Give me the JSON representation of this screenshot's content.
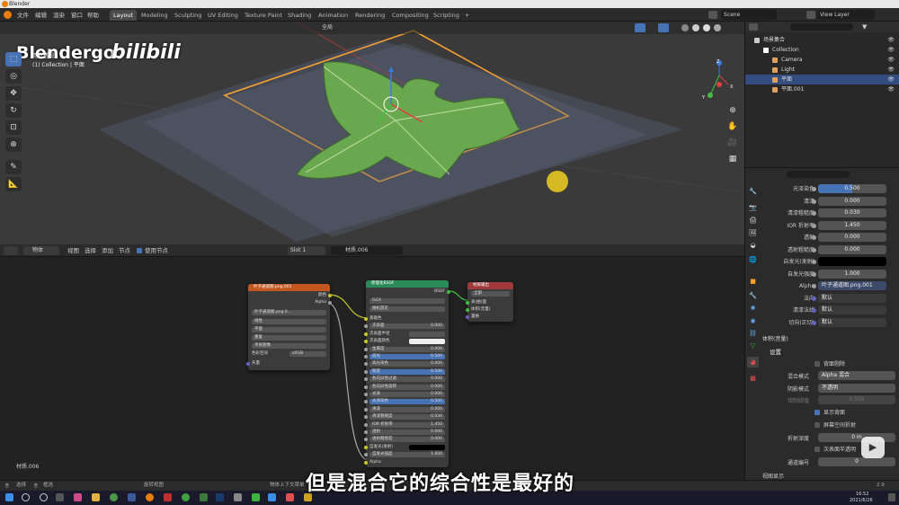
{
  "titlebar": {
    "app": "Blender"
  },
  "menu": {
    "items": [
      "文件",
      "编辑",
      "渲染",
      "窗口",
      "帮助"
    ]
  },
  "workspaces": [
    "Layout",
    "Modeling",
    "Sculpting",
    "UV Editing",
    "Texture Paint",
    "Shading",
    "Animation",
    "Rendering",
    "Compositing",
    "Scripting"
  ],
  "workspace_plus": "+",
  "scene": {
    "label": "Scene",
    "view_layer": "View Layer"
  },
  "viewport": {
    "mode_label": "全局",
    "view_name": "用户透视",
    "collection_info": "(1) Collection | 平面"
  },
  "watermark": {
    "left": "Blendergo",
    "right": "bilibili"
  },
  "tools": [
    {
      "name": "select-box-tool",
      "glyph": "⬚"
    },
    {
      "name": "cursor-tool",
      "glyph": "◎"
    },
    {
      "name": "move-tool",
      "glyph": "✥"
    },
    {
      "name": "rotate-tool",
      "glyph": "↻"
    },
    {
      "name": "scale-tool",
      "glyph": "⊡"
    },
    {
      "name": "transform-tool",
      "glyph": "⊕"
    },
    {
      "name": "annotate-tool",
      "glyph": "✎"
    },
    {
      "name": "measure-tool",
      "glyph": "📐"
    }
  ],
  "gizmo": {
    "x": "X",
    "y": "Y",
    "z": "Z"
  },
  "node_editor": {
    "header": {
      "object_label": "物体",
      "menus": [
        "视图",
        "选择",
        "添加",
        "节点"
      ],
      "use_nodes": "使用节点",
      "slot": "Slot 1",
      "material": "材质.006"
    },
    "footer_material": "材质.006",
    "image_node": {
      "title": "叶子通道图.png.001",
      "outputs": [
        "颜色",
        "Alpha"
      ],
      "image": "叶子通道图.png.0...",
      "interp": "线性",
      "projection": "平面",
      "extension": "重复",
      "source": "单张图像",
      "colorspace_label": "色彩空间",
      "colorspace": "sRGB",
      "vector": "矢量"
    },
    "bsdf_node": {
      "title": "原理化BSDF",
      "output": "BSDF",
      "dist": "GGX",
      "sss": "随机游走",
      "rows": [
        {
          "label": "基础色",
          "value": "",
          "kind": "socket"
        },
        {
          "label": "次表面",
          "value": "0.000",
          "kind": "field"
        },
        {
          "label": "次表面半径",
          "value": "",
          "kind": "drop"
        },
        {
          "label": "次表面颜色",
          "value": "",
          "kind": "color"
        },
        {
          "label": "金属度",
          "value": "0.000",
          "kind": "field"
        },
        {
          "label": "高光",
          "value": "0.500",
          "kind": "blue"
        },
        {
          "label": "高光染色",
          "value": "0.000",
          "kind": "field"
        },
        {
          "label": "糙度",
          "value": "0.500",
          "kind": "blue"
        },
        {
          "label": "各向异性过滤",
          "value": "0.000",
          "kind": "field"
        },
        {
          "label": "各向异性旋转",
          "value": "0.000",
          "kind": "field"
        },
        {
          "label": "光泽",
          "value": "0.000",
          "kind": "field"
        },
        {
          "label": "光泽染色",
          "value": "0.500",
          "kind": "blue"
        },
        {
          "label": "清漆",
          "value": "0.000",
          "kind": "field"
        },
        {
          "label": "清漆粗糙度",
          "value": "0.030",
          "kind": "field"
        },
        {
          "label": "IOR 折射率",
          "value": "1.450",
          "kind": "field"
        },
        {
          "label": "透射",
          "value": "0.000",
          "kind": "field"
        },
        {
          "label": "透射粗糙度",
          "value": "0.000",
          "kind": "field"
        },
        {
          "label": "自发光(发射)",
          "value": "",
          "kind": "black"
        },
        {
          "label": "自发光强度",
          "value": "1.000",
          "kind": "field"
        },
        {
          "label": "Alpha",
          "value": "",
          "kind": "socket"
        }
      ]
    },
    "output_node": {
      "title": "材质输出",
      "target": "全部",
      "inputs": [
        "表(曲)面",
        "体积(音量)",
        "置换"
      ]
    }
  },
  "outliner": {
    "rows": [
      {
        "name": "场景集合",
        "indent": 0,
        "icon": "collection-icon",
        "color": "#cccccc",
        "selected": false
      },
      {
        "name": "Collection",
        "indent": 1,
        "icon": "collection-icon",
        "color": "#ffffff",
        "selected": false
      },
      {
        "name": "Camera",
        "indent": 2,
        "icon": "camera-icon",
        "color": "#e0a060",
        "selected": false
      },
      {
        "name": "Light",
        "indent": 2,
        "icon": "light-icon",
        "color": "#e0a060",
        "selected": false
      },
      {
        "name": "平面",
        "indent": 2,
        "icon": "mesh-icon",
        "color": "#e0a060",
        "selected": true
      },
      {
        "name": "平面.001",
        "indent": 2,
        "icon": "mesh-icon",
        "color": "#e0a060",
        "selected": false
      }
    ]
  },
  "properties": {
    "rows": [
      {
        "label": "光泽染色",
        "value": "0.500",
        "kind": "blue"
      },
      {
        "label": "清漆",
        "value": "0.000",
        "kind": "num"
      },
      {
        "label": "清漆粗糙度",
        "value": "0.030",
        "kind": "num"
      },
      {
        "label": "IOR 折射率",
        "value": "1.450",
        "kind": "num"
      },
      {
        "label": "透射",
        "value": "0.000",
        "kind": "num"
      },
      {
        "label": "透射粗糙度",
        "value": "0.000",
        "kind": "num"
      },
      {
        "label": "自发光(发射)",
        "value": "",
        "kind": "black"
      },
      {
        "label": "自发光强度",
        "value": "1.000",
        "kind": "num"
      },
      {
        "label": "Alpha",
        "value": "叶子通道图.png.001",
        "kind": "link"
      },
      {
        "label": "法向",
        "value": "默认",
        "kind": "text"
      },
      {
        "label": "清漆法线",
        "value": "默认",
        "kind": "text"
      },
      {
        "label": "切向(正切)",
        "value": "默认",
        "kind": "text"
      }
    ],
    "volume_section": "体积(音量)",
    "settings_section": "设置",
    "backface": "背面剔除",
    "blend_label": "混合模式",
    "blend_value": "Alpha 混合",
    "shadow_label": "阴影模式",
    "shadow_value": "不透明",
    "clip_label": "钳制阈值",
    "clip_value": "0.500",
    "show_backface": "显示背面",
    "ssr": "屏幕空间折射",
    "refract_label": "折射深度",
    "refract_value": "0 m",
    "sss_trans": "次表面半透明",
    "pass_label": "通道编号",
    "pass_value": "0",
    "viewport_display": "视图显示"
  },
  "statusbar": {
    "select": "选择",
    "box": "框选",
    "rotate": "旋转视图",
    "context": "物体上下文菜单",
    "version": "2.9"
  },
  "taskbar": {
    "time": "16:52",
    "date": "2021/6/26"
  },
  "subtitle": "但是混合它的综合性是最好的",
  "colors": {
    "accent": "#4772b3",
    "selection_orange": "#f5a030",
    "leaf": "#6aa84f"
  }
}
